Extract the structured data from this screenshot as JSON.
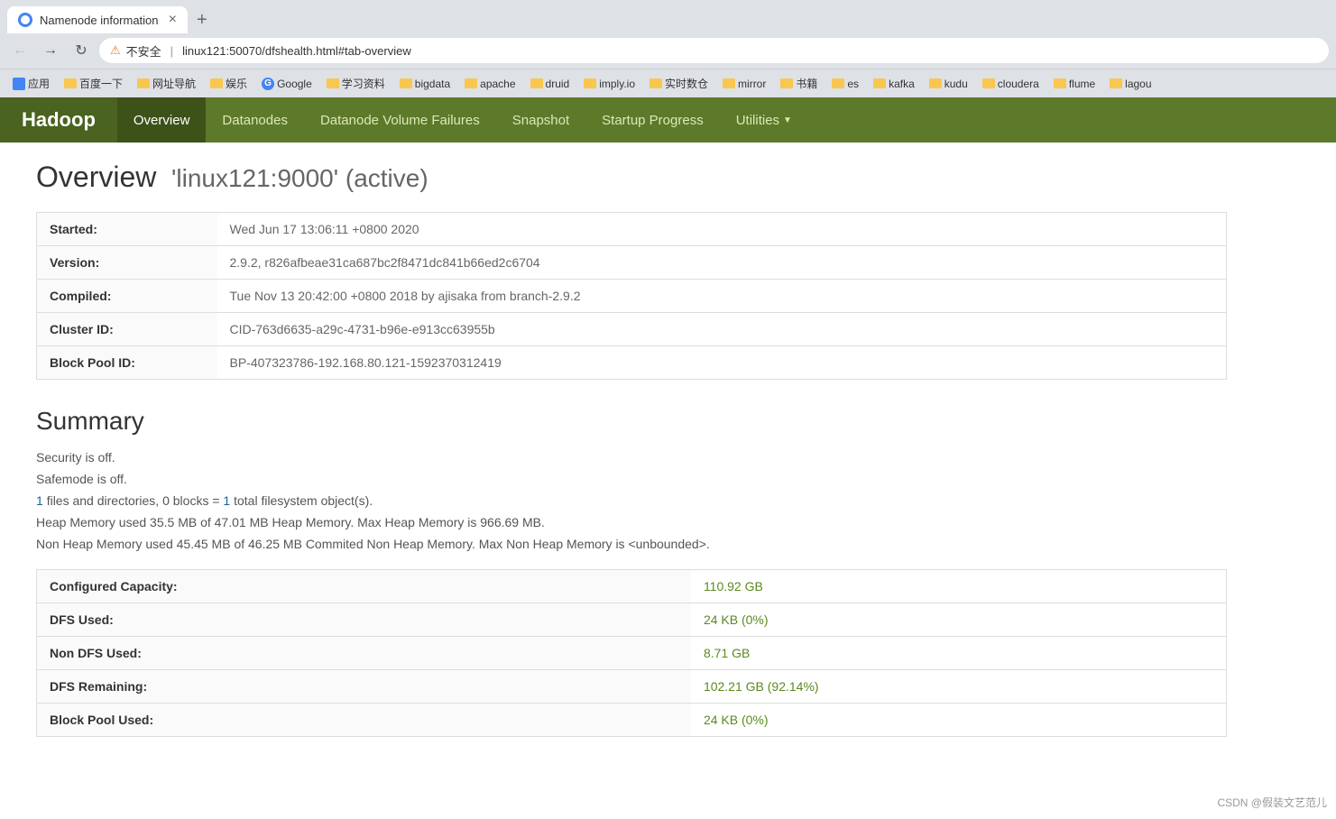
{
  "browser": {
    "tab_title": "Namenode information",
    "tab_label": "Namenode information",
    "address": "linux121:50070/dfshealth.html#tab-overview",
    "address_prefix": "不安全",
    "back_disabled": false,
    "forward_disabled": true,
    "new_tab_label": "+"
  },
  "bookmarks": [
    {
      "label": "应用",
      "icon": "grid"
    },
    {
      "label": "百度一下",
      "icon": "folder"
    },
    {
      "label": "网址导航",
      "icon": "folder"
    },
    {
      "label": "娱乐",
      "icon": "folder"
    },
    {
      "label": "Google",
      "icon": "g"
    },
    {
      "label": "学习资料",
      "icon": "folder"
    },
    {
      "label": "bigdata",
      "icon": "folder"
    },
    {
      "label": "apache",
      "icon": "folder"
    },
    {
      "label": "druid",
      "icon": "folder"
    },
    {
      "label": "imply.io",
      "icon": "folder"
    },
    {
      "label": "实时数仓",
      "icon": "folder"
    },
    {
      "label": "mirror",
      "icon": "folder"
    },
    {
      "label": "书籍",
      "icon": "folder"
    },
    {
      "label": "es",
      "icon": "folder"
    },
    {
      "label": "kafka",
      "icon": "folder"
    },
    {
      "label": "kudu",
      "icon": "folder"
    },
    {
      "label": "cloudera",
      "icon": "folder"
    },
    {
      "label": "flume",
      "icon": "folder"
    },
    {
      "label": "lagou",
      "icon": "folder"
    }
  ],
  "navbar": {
    "brand": "Hadoop",
    "tabs": [
      {
        "label": "Overview",
        "active": true,
        "dropdown": false
      },
      {
        "label": "Datanodes",
        "active": false,
        "dropdown": false
      },
      {
        "label": "Datanode Volume Failures",
        "active": false,
        "dropdown": false
      },
      {
        "label": "Snapshot",
        "active": false,
        "dropdown": false
      },
      {
        "label": "Startup Progress",
        "active": false,
        "dropdown": false
      },
      {
        "label": "Utilities",
        "active": false,
        "dropdown": true
      }
    ]
  },
  "overview": {
    "heading": "Overview",
    "hostname": "'linux121:9000' (active)",
    "rows": [
      {
        "label": "Started:",
        "value": "Wed Jun 17 13:06:11 +0800 2020"
      },
      {
        "label": "Version:",
        "value": "2.9.2, r826afbeae31ca687bc2f8471dc841b66ed2c6704"
      },
      {
        "label": "Compiled:",
        "value": "Tue Nov 13 20:42:00 +0800 2018 by ajisaka from branch-2.9.2"
      },
      {
        "label": "Cluster ID:",
        "value": "CID-763d6635-a29c-4731-b96e-e913cc63955b"
      },
      {
        "label": "Block Pool ID:",
        "value": "BP-407323786-192.168.80.121-1592370312419"
      }
    ]
  },
  "summary": {
    "heading": "Summary",
    "security_status": "Security is off.",
    "safemode_status": "Safemode is off.",
    "filesystem_info": "1 files and directories, 0 blocks = 1 total filesystem object(s).",
    "heap_memory": "Heap Memory used 35.5 MB of 47.01 MB Heap Memory. Max Heap Memory is 966.69 MB.",
    "non_heap_memory": "Non Heap Memory used 45.45 MB of 46.25 MB Commited Non Heap Memory. Max Non Heap Memory is <unbounded>.",
    "table_rows": [
      {
        "label": "Configured Capacity:",
        "value": "110.92 GB"
      },
      {
        "label": "DFS Used:",
        "value": "24 KB (0%)"
      },
      {
        "label": "Non DFS Used:",
        "value": "8.71 GB"
      },
      {
        "label": "DFS Remaining:",
        "value": "102.21 GB (92.14%)"
      },
      {
        "label": "Block Pool Used:",
        "value": "24 KB (0%)"
      }
    ]
  },
  "watermark": "CSDN @假装文艺范儿"
}
